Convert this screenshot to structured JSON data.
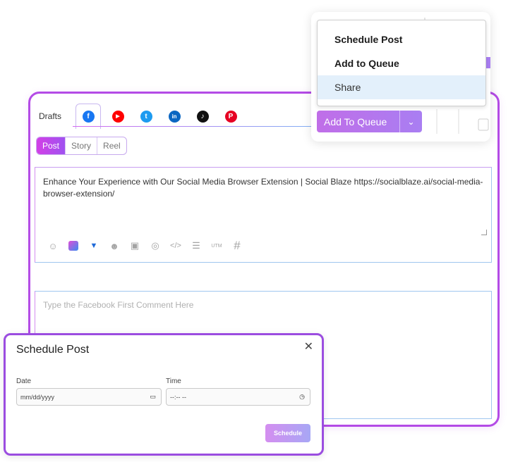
{
  "composer": {
    "drafts_label": "Drafts",
    "networks": [
      {
        "name": "facebook",
        "glyph": "f",
        "color": "#1877f2"
      },
      {
        "name": "youtube",
        "glyph": "▶",
        "color": "#ff0000"
      },
      {
        "name": "twitter",
        "glyph": "t",
        "color": "#1d9bf0"
      },
      {
        "name": "linkedin",
        "glyph": "in",
        "color": "#0a66c2"
      },
      {
        "name": "tiktok",
        "glyph": "♪",
        "color": "#111111"
      },
      {
        "name": "pinterest",
        "glyph": "P",
        "color": "#e60023"
      }
    ],
    "post_types": [
      "Post",
      "Story",
      "Reel"
    ],
    "post_text": "Enhance Your Experience with Our Social Media Browser Extension | Social Blaze https://socialblaze.ai/social-media-browser-extension/",
    "comment_placeholder": "Type the Facebook First Comment Here",
    "tools": [
      "emoji-smile-icon",
      "canva-icon",
      "vista-icon",
      "sticker-icon",
      "image-icon",
      "target-icon",
      "code-icon",
      "template-icon",
      "utm-icon",
      "hashtag-icon"
    ],
    "utm_label": "UTM",
    "hash_label": "#"
  },
  "dropdown": {
    "items": [
      "Schedule Post",
      "Add to Queue",
      "Share"
    ],
    "button_label": "Add To Queue"
  },
  "modal": {
    "title": "Schedule Post",
    "date_label": "Date",
    "date_placeholder": "mm/dd/yyyy",
    "time_label": "Time",
    "time_placeholder": "--:-- --",
    "submit_label": "Schedule"
  },
  "colors": {
    "accent": "#b44be6",
    "menu_highlight": "#e3f0fb"
  }
}
